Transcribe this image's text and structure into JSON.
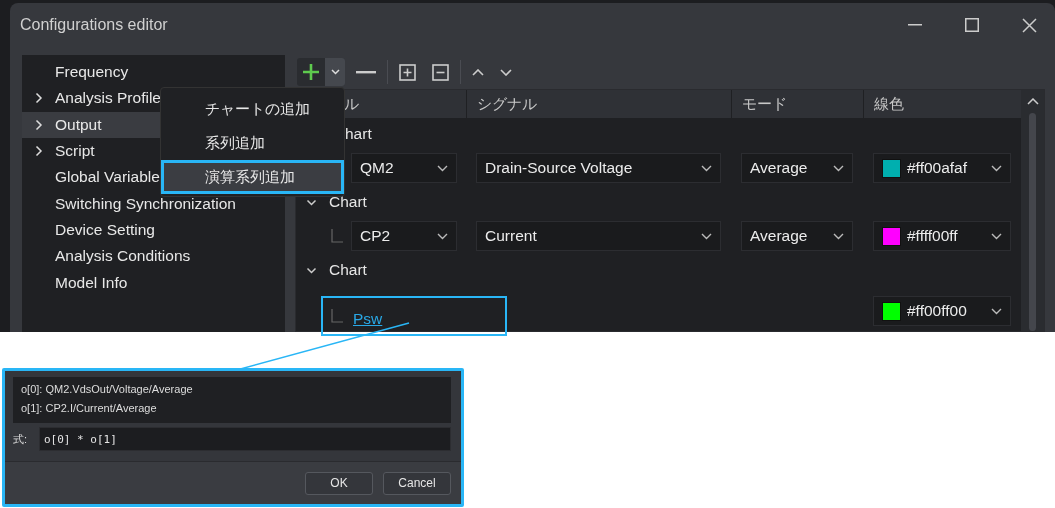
{
  "window": {
    "title": "Configurations editor"
  },
  "sidebar": {
    "items": [
      {
        "label": "Frequency",
        "expandable": false,
        "selected": false
      },
      {
        "label": "Analysis Profile",
        "expandable": true,
        "selected": false
      },
      {
        "label": "Output",
        "expandable": true,
        "selected": true
      },
      {
        "label": "Script",
        "expandable": true,
        "selected": false
      },
      {
        "label": "Global Variable",
        "expandable": false,
        "selected": false
      },
      {
        "label": "Switching Synchronization",
        "expandable": false,
        "selected": false
      },
      {
        "label": "Device Setting",
        "expandable": false,
        "selected": false
      },
      {
        "label": "Analysis Conditions",
        "expandable": false,
        "selected": false
      },
      {
        "label": "Model Info",
        "expandable": false,
        "selected": false
      }
    ]
  },
  "add_menu": {
    "items": [
      {
        "label": "チャートの追加",
        "selected": false
      },
      {
        "label": "系列追加",
        "selected": false
      },
      {
        "label": "演算系列追加",
        "selected": true
      }
    ]
  },
  "table": {
    "columns": [
      "ル",
      "シグナル",
      "モード",
      "線色"
    ],
    "charts": [
      {
        "label": "hart",
        "series": [
          {
            "kind": "signal",
            "highlighted": false,
            "element": "QM2",
            "signal": "Drain-Source Voltage",
            "mode": "Average",
            "color": "#00afaf",
            "color_label": "#ff00afaf"
          }
        ]
      },
      {
        "label": "Chart",
        "expanded": true,
        "series": [
          {
            "kind": "signal",
            "highlighted": false,
            "element": "CP2",
            "signal": "Current",
            "mode": "Average",
            "color": "#ff00ff",
            "color_label": "#ffff00ff"
          }
        ]
      },
      {
        "label": "Chart",
        "expanded": true,
        "series": [
          {
            "kind": "formula",
            "highlighted": true,
            "name": "Psw",
            "color": "#00ff00",
            "color_label": "#ff00ff00"
          }
        ]
      }
    ]
  },
  "formula_dialog": {
    "operands": [
      "o[0]: QM2.VdsOut/Voltage/Average",
      "o[1]: CP2.I/Current/Average"
    ],
    "formula_label": "式:",
    "formula": "o[0] * o[1]",
    "buttons": [
      "OK",
      "Cancel"
    ]
  }
}
